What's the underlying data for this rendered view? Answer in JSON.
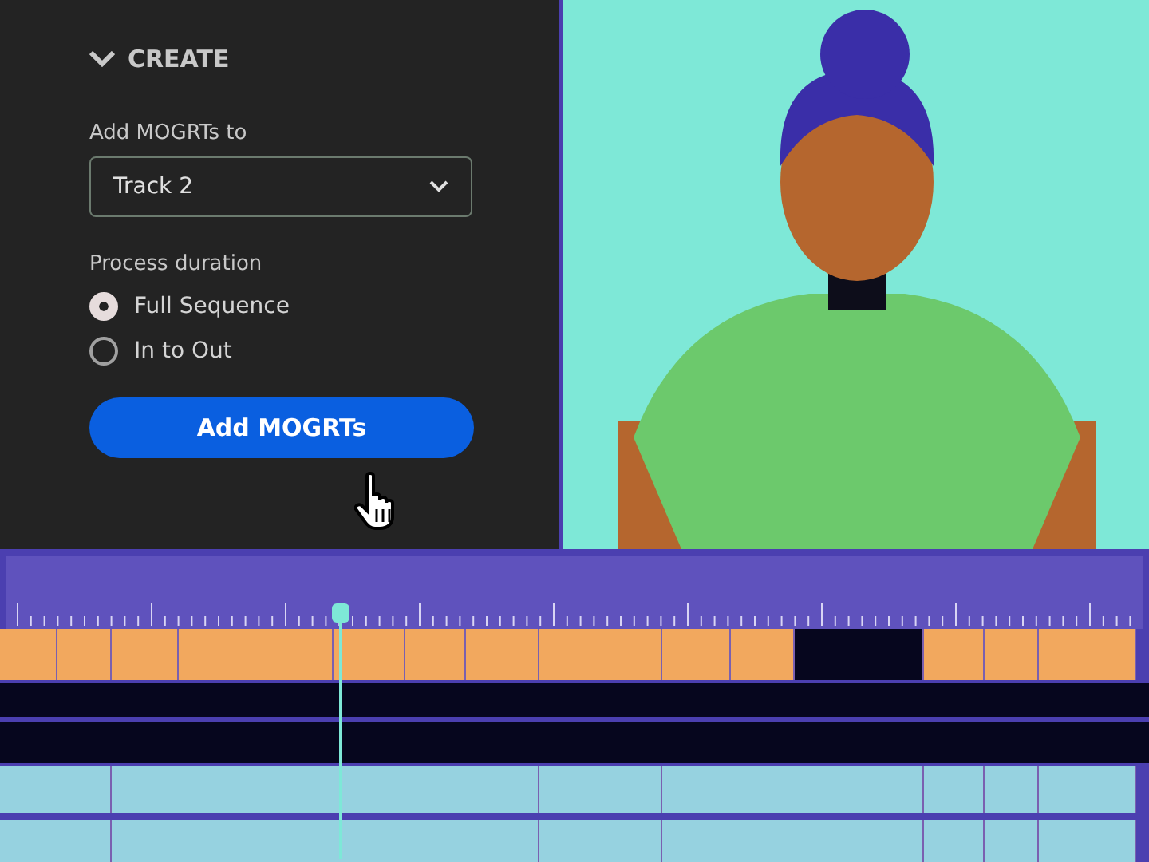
{
  "panel": {
    "section": {
      "title": "CREATE",
      "expanded": true
    },
    "target": {
      "label": "Add MOGRTs to",
      "value": "Track 2"
    },
    "duration": {
      "label": "Process duration",
      "options": [
        {
          "label": "Full Sequence",
          "selected": true
        },
        {
          "label": "In to Out",
          "selected": false
        }
      ]
    },
    "button": "Add MOGRTs"
  }
}
